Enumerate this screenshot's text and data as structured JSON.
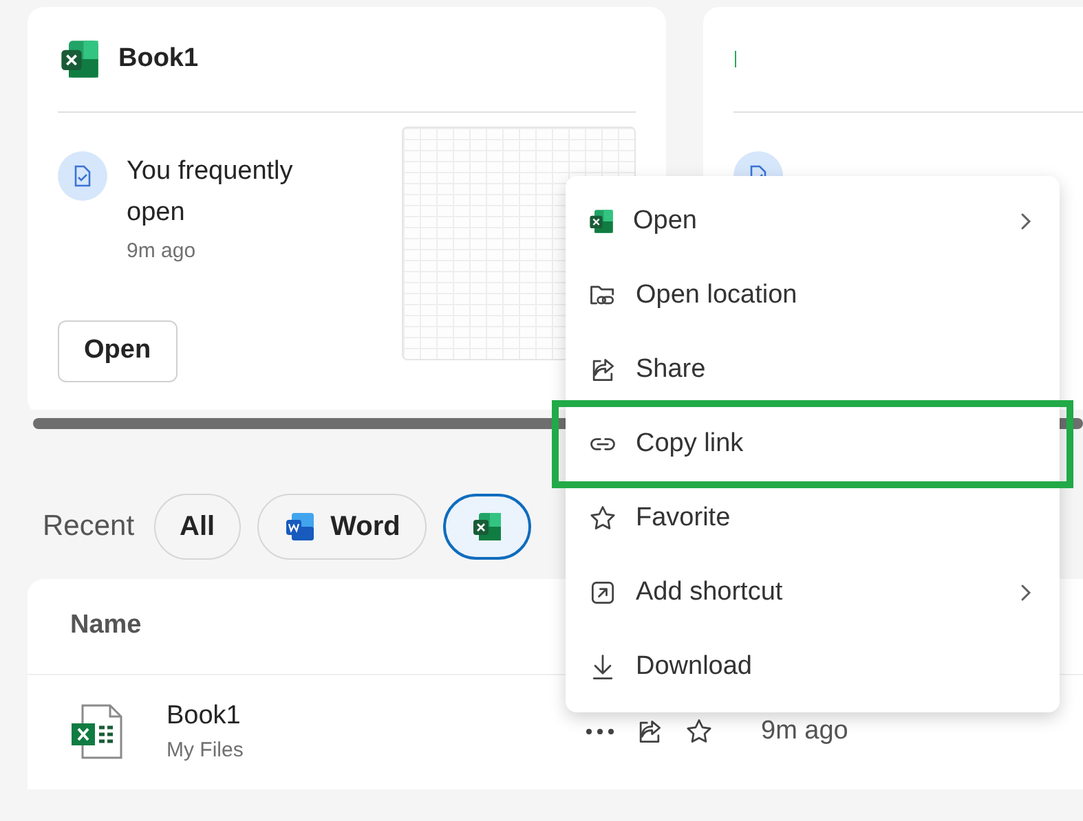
{
  "cards": [
    {
      "title": "Book1",
      "reason": "You frequently open",
      "time": "9m ago",
      "button": "Open",
      "loading": false
    },
    {
      "loading": true
    }
  ],
  "recent": {
    "label": "Recent",
    "filters": [
      {
        "label": "All",
        "selected": false
      },
      {
        "label": "Word",
        "selected": false
      },
      {
        "selected": true
      }
    ]
  },
  "table": {
    "columns": [
      "Name"
    ],
    "rows": [
      {
        "name": "Book1",
        "location": "My Files",
        "time": "9m ago"
      }
    ]
  },
  "context_menu": {
    "items": [
      {
        "label": "Open",
        "submenu": true,
        "highlighted": false
      },
      {
        "label": "Open location",
        "submenu": false,
        "highlighted": false
      },
      {
        "label": "Share",
        "submenu": false,
        "highlighted": false
      },
      {
        "label": "Copy link",
        "submenu": false,
        "highlighted": true
      },
      {
        "label": "Favorite",
        "submenu": false,
        "highlighted": false
      },
      {
        "label": "Add shortcut",
        "submenu": true,
        "highlighted": false
      },
      {
        "label": "Download",
        "submenu": false,
        "highlighted": false
      }
    ]
  }
}
